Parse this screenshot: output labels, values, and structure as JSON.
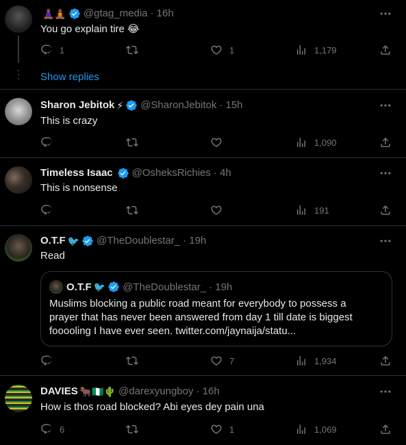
{
  "colors": {
    "background": "#000000",
    "text": "#e7e9ea",
    "muted": "#71767b",
    "accent": "#1d9bf0",
    "border": "#2f3336"
  },
  "tweets": [
    {
      "name": "",
      "name_emoji": "🧘🏾‍♀️🧘🏾",
      "handle": "@gtag_media",
      "time": "· 16h",
      "text": "You go explain tire 😂",
      "replies": "1",
      "retweets": "",
      "likes": "1",
      "views": "1,179"
    },
    {
      "name": "Sharon Jebitok",
      "name_emoji": "⚡",
      "handle": "@SharonJebitok",
      "time": "· 15h",
      "text": "This is crazy",
      "replies": "",
      "retweets": "",
      "likes": "",
      "views": "1,090"
    },
    {
      "name": "Timeless Isaac",
      "name_emoji": "",
      "handle": "@OsheksRichies",
      "time": "· 4h",
      "text": "This is nonsense",
      "replies": "",
      "retweets": "",
      "likes": "",
      "views": "191"
    },
    {
      "name": "O.T.F",
      "name_emoji": "🐦",
      "handle": "@TheDoublestar_",
      "time": "· 19h",
      "text": "Read",
      "replies": "",
      "retweets": "",
      "likes": "7",
      "views": "1,934",
      "quote": {
        "name": "O.T.F",
        "name_emoji": "🐦",
        "handle": "@TheDoublestar_",
        "time": "· 19h",
        "text": "Muslims blocking a public road meant for everybody to possess a prayer that has never been answered from day 1 till date is biggest fooooling I have ever seen. twitter.com/jaynaija/statu..."
      }
    },
    {
      "name": "DAVIES",
      "name_emoji": "🐂🇳🇬🌵",
      "handle": "@darexyungboy",
      "time": "· 16h",
      "text": "How is thos road blocked? Abi eyes dey pain una",
      "replies": "6",
      "retweets": "",
      "likes": "1",
      "views": "1,069"
    }
  ],
  "show_replies_label": "Show replies",
  "icons": {
    "reply": "reply-icon",
    "retweet": "retweet-icon",
    "like": "heart-icon",
    "views": "views-chart-icon",
    "share": "share-icon",
    "more": "more-options-icon",
    "verified": "verified-badge-icon"
  }
}
